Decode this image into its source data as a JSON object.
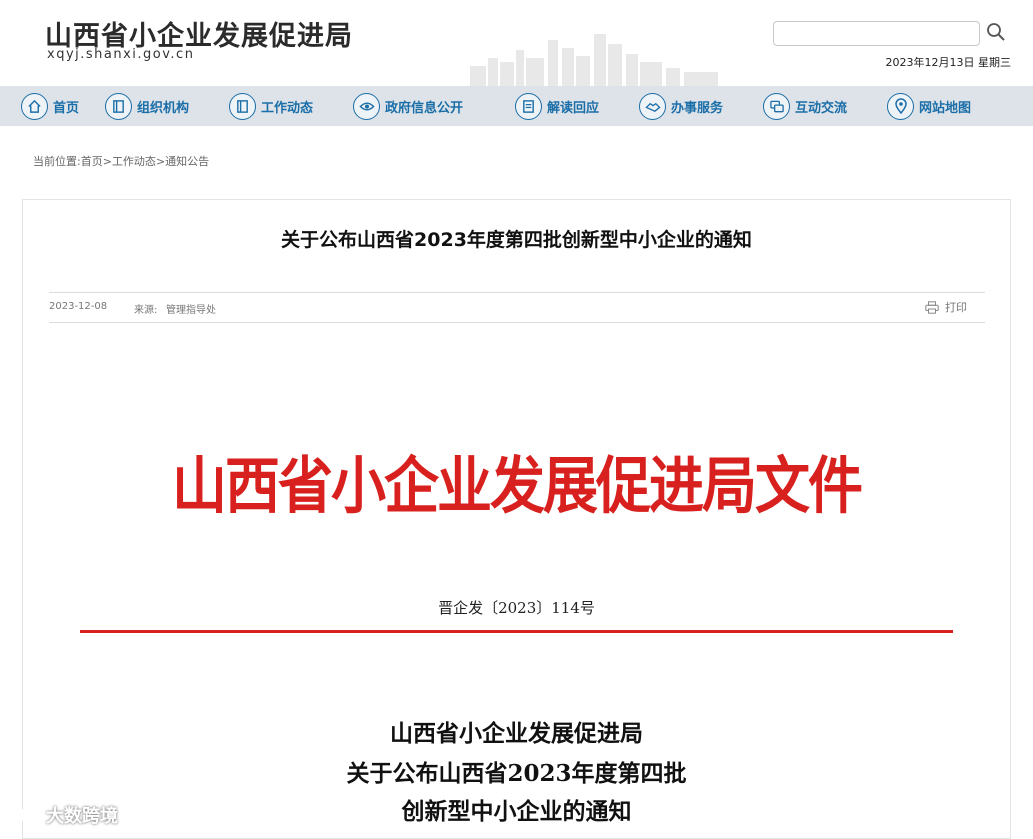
{
  "header": {
    "site_title": "山西省小企业发展促进局",
    "site_domain": "xqyj.shanxi.gov.cn",
    "date_line": "2023年12月13日 星期三",
    "search": {
      "value": "",
      "placeholder": ""
    }
  },
  "nav": {
    "items": [
      {
        "label": "首页",
        "icon": "home-icon"
      },
      {
        "label": "组织机构",
        "icon": "organization-icon"
      },
      {
        "label": "工作动态",
        "icon": "work-news-icon"
      },
      {
        "label": "政府信息公开",
        "icon": "eye-icon"
      },
      {
        "label": "解读回应",
        "icon": "interpret-icon"
      },
      {
        "label": "办事服务",
        "icon": "handshake-icon"
      },
      {
        "label": "互动交流",
        "icon": "chat-icon"
      },
      {
        "label": "网站地图",
        "icon": "map-pin-icon"
      }
    ]
  },
  "breadcrumb": {
    "prefix": "当前位置:",
    "items": [
      "首页",
      "工作动态",
      "通知公告"
    ],
    "separator": ">"
  },
  "article": {
    "title": "关于公布山西省2023年度第四批创新型中小企业的通知",
    "date": "2023-12-08",
    "source_label": "来源:",
    "source": "管理指导处",
    "print_label": "打印",
    "doc_header": "山西省小企业发展促进局文件",
    "doc_number": "晋企发〔2023〕114号",
    "subtitle_lines": [
      "山西省小企业发展促进局",
      "关于公布山西省2023年度第四批",
      "创新型中小企业的通知"
    ]
  },
  "watermark": {
    "text": "大数跨境"
  },
  "colors": {
    "accent": "#1b6ea8",
    "nav_bg": "#dde3e8",
    "official_red": "#d8211e"
  }
}
